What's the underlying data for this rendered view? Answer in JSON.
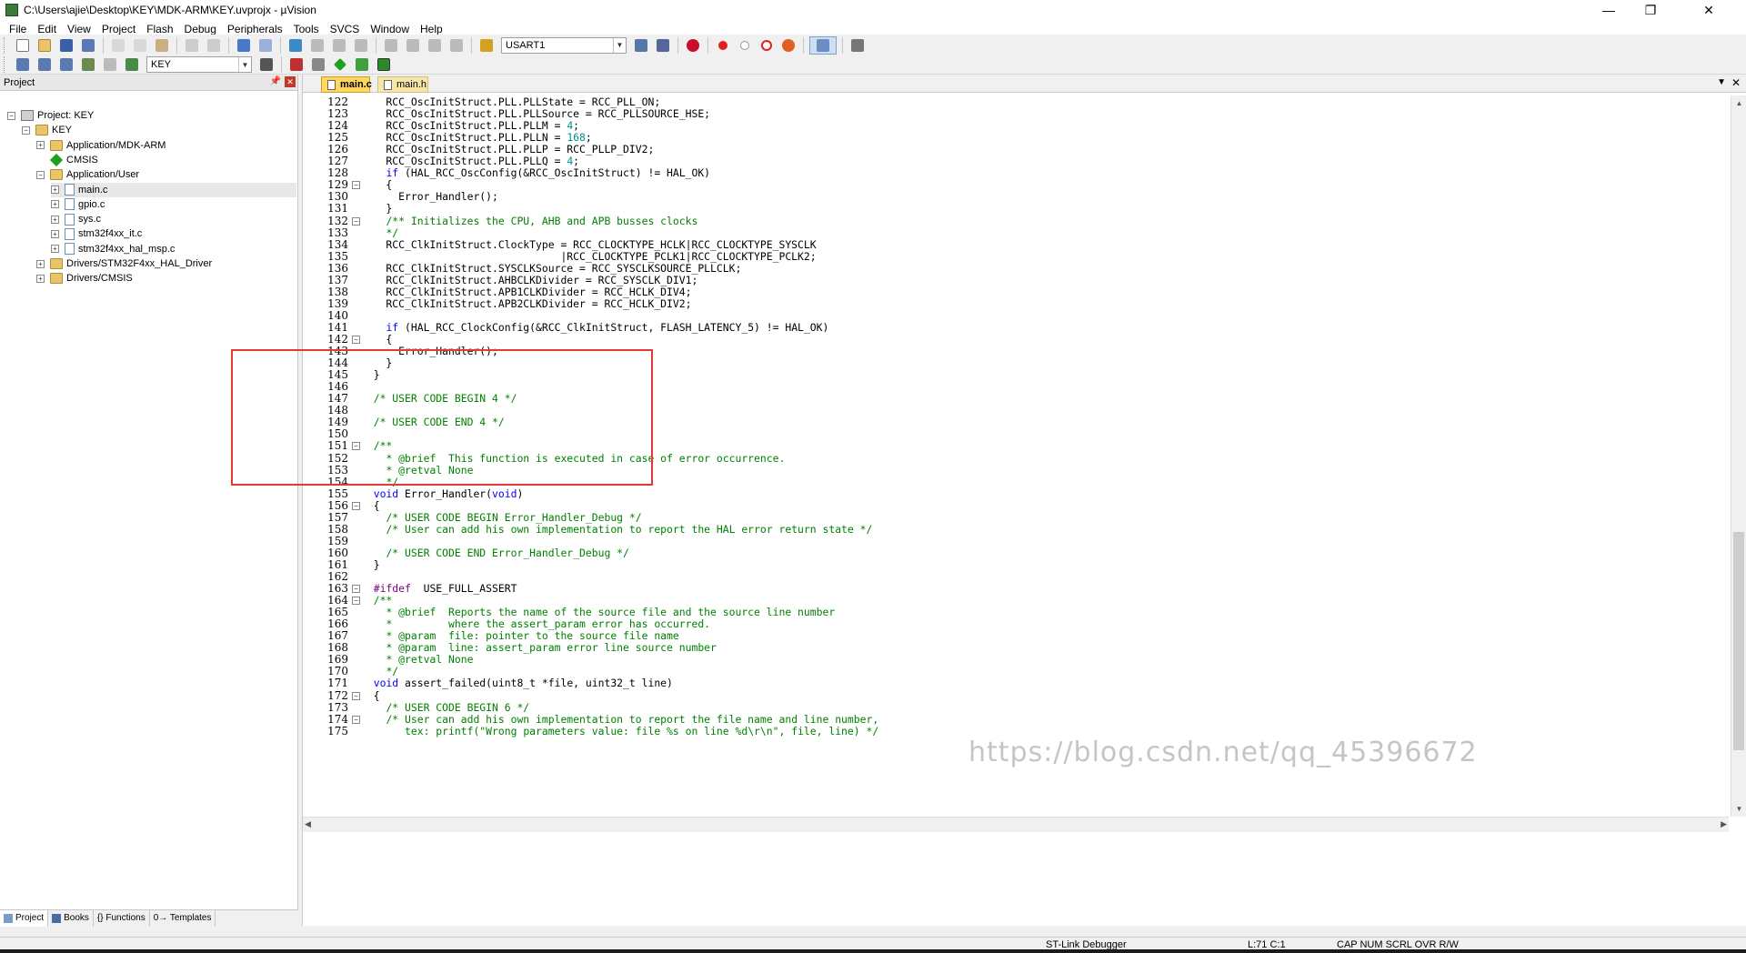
{
  "window": {
    "title": "C:\\Users\\ajie\\Desktop\\KEY\\MDK-ARM\\KEY.uvprojx - µVision",
    "minimize": "—",
    "maximize": "❐",
    "close": "✕"
  },
  "menu": [
    "File",
    "Edit",
    "View",
    "Project",
    "Flash",
    "Debug",
    "Peripherals",
    "Tools",
    "SVCS",
    "Window",
    "Help"
  ],
  "toolbar1": {
    "combo_value": "USART1"
  },
  "toolbar2": {
    "target_value": "KEY"
  },
  "project_pane": {
    "title": "Project",
    "tree": [
      {
        "label": "Project: KEY",
        "level": 0,
        "type": "project",
        "expander": "⊟"
      },
      {
        "label": "KEY",
        "level": 1,
        "type": "folder",
        "expander": "⊟"
      },
      {
        "label": "Application/MDK-ARM",
        "level": 2,
        "type": "folder",
        "expander": "⊞"
      },
      {
        "label": "CMSIS",
        "level": 2,
        "type": "diamond",
        "expander": ""
      },
      {
        "label": "Application/User",
        "level": 2,
        "type": "folder",
        "expander": "⊟"
      },
      {
        "label": "main.c",
        "level": 3,
        "type": "file",
        "expander": "⊞",
        "selected": true
      },
      {
        "label": "gpio.c",
        "level": 3,
        "type": "file",
        "expander": "⊞"
      },
      {
        "label": "sys.c",
        "level": 3,
        "type": "file",
        "expander": "⊞"
      },
      {
        "label": "stm32f4xx_it.c",
        "level": 3,
        "type": "file",
        "expander": "⊞"
      },
      {
        "label": "stm32f4xx_hal_msp.c",
        "level": 3,
        "type": "file",
        "expander": "⊞"
      },
      {
        "label": "Drivers/STM32F4xx_HAL_Driver",
        "level": 2,
        "type": "folder",
        "expander": "⊞"
      },
      {
        "label": "Drivers/CMSIS",
        "level": 2,
        "type": "folder",
        "expander": "⊞"
      }
    ],
    "tabs": [
      "Project",
      "Books",
      "{} Functions",
      "0→ Templates"
    ]
  },
  "editor": {
    "tabs": [
      "main.c",
      "main.h"
    ],
    "lines": [
      {
        "n": "122",
        "fold": "",
        "t": [
          [
            "    RCC_OscInitStruct.PLL.PLLState = RCC_PLL_ON;",
            ""
          ]
        ]
      },
      {
        "n": "123",
        "fold": "",
        "t": [
          [
            "    RCC_OscInitStruct.PLL.PLLSource = RCC_PLLSOURCE_HSE;",
            ""
          ]
        ]
      },
      {
        "n": "124",
        "fold": "",
        "t": [
          [
            "    RCC_OscInitStruct.PLL.PLLM = ",
            ""
          ],
          [
            "4",
            "num"
          ],
          [
            ";",
            ""
          ]
        ]
      },
      {
        "n": "125",
        "fold": "",
        "t": [
          [
            "    RCC_OscInitStruct.PLL.PLLN = ",
            ""
          ],
          [
            "168",
            "num"
          ],
          [
            ";",
            ""
          ]
        ]
      },
      {
        "n": "126",
        "fold": "",
        "t": [
          [
            "    RCC_OscInitStruct.PLL.PLLP = RCC_PLLP_DIV2;",
            ""
          ]
        ]
      },
      {
        "n": "127",
        "fold": "",
        "t": [
          [
            "    RCC_OscInitStruct.PLL.PLLQ = ",
            ""
          ],
          [
            "4",
            "num"
          ],
          [
            ";",
            ""
          ]
        ]
      },
      {
        "n": "128",
        "fold": "",
        "t": [
          [
            "    ",
            ""
          ],
          [
            "if",
            "kw"
          ],
          [
            " (HAL_RCC_OscConfig(&RCC_OscInitStruct) != HAL_OK)",
            ""
          ]
        ]
      },
      {
        "n": "129",
        "fold": "⊟",
        "t": [
          [
            "    {",
            ""
          ]
        ]
      },
      {
        "n": "130",
        "fold": "",
        "t": [
          [
            "      Error_Handler();",
            ""
          ]
        ]
      },
      {
        "n": "131",
        "fold": "",
        "t": [
          [
            "    }",
            ""
          ]
        ]
      },
      {
        "n": "132",
        "fold": "⊟",
        "t": [
          [
            "    ",
            ""
          ],
          [
            "/** Initializes the CPU, AHB and APB busses clocks",
            "cm"
          ]
        ]
      },
      {
        "n": "133",
        "fold": "",
        "t": [
          [
            "    ",
            ""
          ],
          [
            "*/",
            "cm"
          ]
        ]
      },
      {
        "n": "134",
        "fold": "",
        "t": [
          [
            "    RCC_ClkInitStruct.ClockType = RCC_CLOCKTYPE_HCLK|RCC_CLOCKTYPE_SYSCLK",
            ""
          ]
        ]
      },
      {
        "n": "135",
        "fold": "",
        "t": [
          [
            "                                |RCC_CLOCKTYPE_PCLK1|RCC_CLOCKTYPE_PCLK2;",
            ""
          ]
        ]
      },
      {
        "n": "136",
        "fold": "",
        "t": [
          [
            "    RCC_ClkInitStruct.SYSCLKSource = RCC_SYSCLKSOURCE_PLLCLK;",
            ""
          ]
        ]
      },
      {
        "n": "137",
        "fold": "",
        "t": [
          [
            "    RCC_ClkInitStruct.AHBCLKDivider = RCC_SYSCLK_DIV1;",
            ""
          ]
        ]
      },
      {
        "n": "138",
        "fold": "",
        "t": [
          [
            "    RCC_ClkInitStruct.APB1CLKDivider = RCC_HCLK_DIV4;",
            ""
          ]
        ]
      },
      {
        "n": "139",
        "fold": "",
        "t": [
          [
            "    RCC_ClkInitStruct.APB2CLKDivider = RCC_HCLK_DIV2;",
            ""
          ]
        ]
      },
      {
        "n": "140",
        "fold": "",
        "t": [
          [
            "",
            ""
          ]
        ]
      },
      {
        "n": "141",
        "fold": "",
        "t": [
          [
            "    ",
            ""
          ],
          [
            "if",
            "kw"
          ],
          [
            " (HAL_RCC_ClockConfig(&RCC_ClkInitStruct, FLASH_LATENCY_5) != HAL_OK)",
            ""
          ]
        ]
      },
      {
        "n": "142",
        "fold": "⊟",
        "t": [
          [
            "    {",
            ""
          ]
        ]
      },
      {
        "n": "143",
        "fold": "",
        "t": [
          [
            "      Error_Handler();",
            ""
          ]
        ]
      },
      {
        "n": "144",
        "fold": "",
        "t": [
          [
            "    }",
            ""
          ]
        ]
      },
      {
        "n": "145",
        "fold": "",
        "t": [
          [
            "  }",
            ""
          ]
        ]
      },
      {
        "n": "146",
        "fold": "",
        "t": [
          [
            "",
            ""
          ]
        ]
      },
      {
        "n": "147",
        "fold": "",
        "t": [
          [
            "  ",
            ""
          ],
          [
            "/* USER CODE BEGIN 4 */",
            "cm"
          ]
        ]
      },
      {
        "n": "148",
        "fold": "",
        "t": [
          [
            "",
            ""
          ]
        ]
      },
      {
        "n": "149",
        "fold": "",
        "t": [
          [
            "  ",
            ""
          ],
          [
            "/* USER CODE END 4 */",
            "cm"
          ]
        ]
      },
      {
        "n": "150",
        "fold": "",
        "t": [
          [
            "",
            ""
          ]
        ]
      },
      {
        "n": "151",
        "fold": "⊟",
        "t": [
          [
            "  ",
            ""
          ],
          [
            "/**",
            "cm"
          ]
        ]
      },
      {
        "n": "152",
        "fold": "",
        "t": [
          [
            "    ",
            ""
          ],
          [
            "* @brief  This function is executed in case of error occurrence.",
            "cm"
          ]
        ]
      },
      {
        "n": "153",
        "fold": "",
        "t": [
          [
            "    ",
            ""
          ],
          [
            "* @retval None",
            "cm"
          ]
        ]
      },
      {
        "n": "154",
        "fold": "",
        "t": [
          [
            "    ",
            ""
          ],
          [
            "*/",
            "cm"
          ]
        ]
      },
      {
        "n": "155",
        "fold": "",
        "t": [
          [
            "  ",
            ""
          ],
          [
            "void",
            "kw"
          ],
          [
            " Error_Handler(",
            ""
          ],
          [
            "void",
            "kw"
          ],
          [
            ")",
            ""
          ]
        ]
      },
      {
        "n": "156",
        "fold": "⊟",
        "t": [
          [
            "  {",
            ""
          ]
        ]
      },
      {
        "n": "157",
        "fold": "",
        "t": [
          [
            "    ",
            ""
          ],
          [
            "/* USER CODE BEGIN Error_Handler_Debug */",
            "cm"
          ]
        ]
      },
      {
        "n": "158",
        "fold": "",
        "t": [
          [
            "    ",
            ""
          ],
          [
            "/* User can add his own implementation to report the HAL error return state */",
            "cm"
          ]
        ]
      },
      {
        "n": "159",
        "fold": "",
        "t": [
          [
            "",
            ""
          ]
        ]
      },
      {
        "n": "160",
        "fold": "",
        "t": [
          [
            "    ",
            ""
          ],
          [
            "/* USER CODE END Error_Handler_Debug */",
            "cm"
          ]
        ]
      },
      {
        "n": "161",
        "fold": "",
        "t": [
          [
            "  }",
            ""
          ]
        ]
      },
      {
        "n": "162",
        "fold": "",
        "t": [
          [
            "",
            ""
          ]
        ]
      },
      {
        "n": "163",
        "fold": "⊟",
        "t": [
          [
            "  ",
            ""
          ],
          [
            "#ifdef",
            "pp"
          ],
          [
            "  USE_FULL_ASSERT",
            ""
          ]
        ]
      },
      {
        "n": "164",
        "fold": "⊟",
        "t": [
          [
            "  ",
            ""
          ],
          [
            "/**",
            "cm"
          ]
        ]
      },
      {
        "n": "165",
        "fold": "",
        "t": [
          [
            "    ",
            ""
          ],
          [
            "* @brief  Reports the name of the source file and the source line number",
            "cm"
          ]
        ]
      },
      {
        "n": "166",
        "fold": "",
        "t": [
          [
            "    ",
            ""
          ],
          [
            "*         where the assert_param error has occurred.",
            "cm"
          ]
        ]
      },
      {
        "n": "167",
        "fold": "",
        "t": [
          [
            "    ",
            ""
          ],
          [
            "* @param  file: pointer to the source file name",
            "cm"
          ]
        ]
      },
      {
        "n": "168",
        "fold": "",
        "t": [
          [
            "    ",
            ""
          ],
          [
            "* @param  line: assert_param error line source number",
            "cm"
          ]
        ]
      },
      {
        "n": "169",
        "fold": "",
        "t": [
          [
            "    ",
            ""
          ],
          [
            "* @retval None",
            "cm"
          ]
        ]
      },
      {
        "n": "170",
        "fold": "",
        "t": [
          [
            "    ",
            ""
          ],
          [
            "*/",
            "cm"
          ]
        ]
      },
      {
        "n": "171",
        "fold": "",
        "t": [
          [
            "  ",
            ""
          ],
          [
            "void",
            "kw"
          ],
          [
            " assert_failed(uint8_t *file, uint32_t line)",
            ""
          ]
        ]
      },
      {
        "n": "172",
        "fold": "⊟",
        "t": [
          [
            "  {",
            ""
          ]
        ]
      },
      {
        "n": "173",
        "fold": "",
        "t": [
          [
            "    ",
            ""
          ],
          [
            "/* USER CODE BEGIN 6 */",
            "cm"
          ]
        ]
      },
      {
        "n": "174",
        "fold": "⊟",
        "t": [
          [
            "    ",
            ""
          ],
          [
            "/* User can add his own implementation to report the file name and line number,",
            "cm"
          ]
        ]
      },
      {
        "n": "175",
        "fold": "",
        "t": [
          [
            "       ",
            ""
          ],
          [
            "tex: printf(\"Wrong parameters value: file %s on line %d\\r\\n\", file, line) */",
            "cm"
          ]
        ]
      }
    ]
  },
  "status": {
    "debugger": "ST-Link Debugger",
    "position": "L:71 C:1",
    "flags": "CAP  NUM  SCRL  OVR  R/W"
  },
  "watermark": "https://blog.csdn.net/qq_45396672",
  "colors": {
    "keyword": "#0000ff",
    "comment": "#008000",
    "number": "#009090",
    "preprocessor": "#800080",
    "active_tab": "#ffd75e",
    "highlight_box": "#e53935"
  }
}
